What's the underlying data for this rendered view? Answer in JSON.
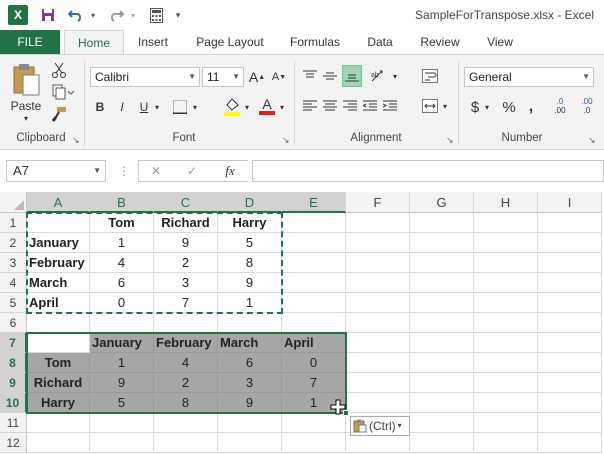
{
  "window": {
    "title": "SampleForTranspose.xlsx - Excel"
  },
  "tabs": [
    "FILE",
    "Home",
    "Insert",
    "Page Layout",
    "Formulas",
    "Data",
    "Review",
    "View"
  ],
  "ribbon": {
    "clipboard": {
      "paste_label": "Paste",
      "group_label": "Clipboard"
    },
    "font": {
      "font_name": "Calibri",
      "font_size": "11",
      "group_label": "Font",
      "bold": "B",
      "italic": "I",
      "underline": "U",
      "grow": "A",
      "shrink": "A",
      "font_color_letter": "A"
    },
    "alignment": {
      "group_label": "Alignment"
    },
    "number": {
      "format": "General",
      "group_label": "Number",
      "currency": "$",
      "percent": "%",
      "comma": ",",
      "inc_decimal": ".0",
      "dec_decimal": ".00"
    }
  },
  "formula_bar": {
    "name_box": "A7",
    "fx": "fx",
    "cancel": "✕",
    "enter": "✓"
  },
  "sheet": {
    "columns": [
      "A",
      "B",
      "C",
      "D",
      "E",
      "F",
      "G",
      "H",
      "I"
    ],
    "rows": [
      "1",
      "2",
      "3",
      "4",
      "5",
      "6",
      "7",
      "8",
      "9",
      "10",
      "11",
      "12"
    ],
    "cells": {
      "B1": "Tom",
      "C1": "Richard",
      "D1": "Harry",
      "A2": "January",
      "B2": "1",
      "C2": "9",
      "D2": "5",
      "A3": "February",
      "B3": "4",
      "C3": "2",
      "D3": "8",
      "A4": "March",
      "B4": "6",
      "C4": "3",
      "D4": "9",
      "A5": "April",
      "B5": "0",
      "C5": "7",
      "D5": "1",
      "B7": "January",
      "C7": "February",
      "D7": "March",
      "E7": "April",
      "A8": "Tom",
      "B8": "1",
      "C8": "4",
      "D8": "6",
      "E8": "0",
      "A9": "Richard",
      "B9": "9",
      "C9": "2",
      "D9": "3",
      "E9": "7",
      "A10": "Harry",
      "B10": "5",
      "C10": "8",
      "D10": "9",
      "E10": "1"
    }
  },
  "paste_options": {
    "label": "(Ctrl)"
  }
}
